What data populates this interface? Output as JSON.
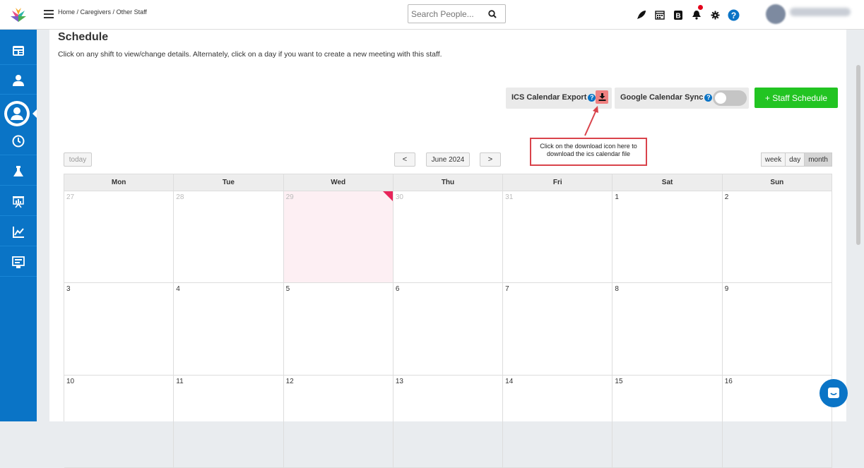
{
  "header": {
    "breadcrumb": [
      "Home",
      "Caregivers",
      "Other Staff"
    ],
    "breadcrumb_sep": " / ",
    "search_placeholder": "Search People...",
    "icons": [
      "rocket-icon",
      "calendar-icon",
      "badge-icon",
      "bell-icon",
      "gear-icon",
      "help-icon"
    ]
  },
  "sidebar": {
    "items": [
      "dashboard-icon",
      "person-icon",
      "user-circle-icon",
      "clock-icon",
      "lab-flask-icon",
      "presentation-icon",
      "chart-icon",
      "monitor-icon"
    ],
    "active_index": 2
  },
  "page": {
    "title": "Schedule",
    "instructions": "Click on any shift to view/change details. Alternately, click on a day if you want to create a new meeting with this staff."
  },
  "controls": {
    "ics_label": "ICS Calendar Export",
    "gcal_label": "Google Calendar Sync",
    "staff_schedule_label": "+ Staff Schedule",
    "gcal_sync_on": false
  },
  "callout": {
    "line1": "Click on the download icon here to",
    "line2": "download the ics calendar file"
  },
  "calendar": {
    "today_label": "today",
    "prev_label": "<",
    "next_label": ">",
    "month_label": "June 2024",
    "views": [
      "week",
      "day",
      "month"
    ],
    "active_view": "month",
    "weekdays": [
      "Mon",
      "Tue",
      "Wed",
      "Thu",
      "Fri",
      "Sat",
      "Sun"
    ],
    "rows": [
      [
        {
          "d": "27",
          "other": true
        },
        {
          "d": "28",
          "other": true
        },
        {
          "d": "29",
          "other": true,
          "today": true
        },
        {
          "d": "30",
          "other": true
        },
        {
          "d": "31",
          "other": true
        },
        {
          "d": "1"
        },
        {
          "d": "2"
        }
      ],
      [
        {
          "d": "3"
        },
        {
          "d": "4"
        },
        {
          "d": "5"
        },
        {
          "d": "6"
        },
        {
          "d": "7"
        },
        {
          "d": "8"
        },
        {
          "d": "9"
        }
      ],
      [
        {
          "d": "10"
        },
        {
          "d": "11"
        },
        {
          "d": "12"
        },
        {
          "d": "13"
        },
        {
          "d": "14"
        },
        {
          "d": "15"
        },
        {
          "d": "16"
        }
      ]
    ]
  },
  "colors": {
    "sidebar": "#0a74c6",
    "accent_green": "#22c422",
    "today_bg": "#fdeff3",
    "callout_border": "#d9434b"
  }
}
